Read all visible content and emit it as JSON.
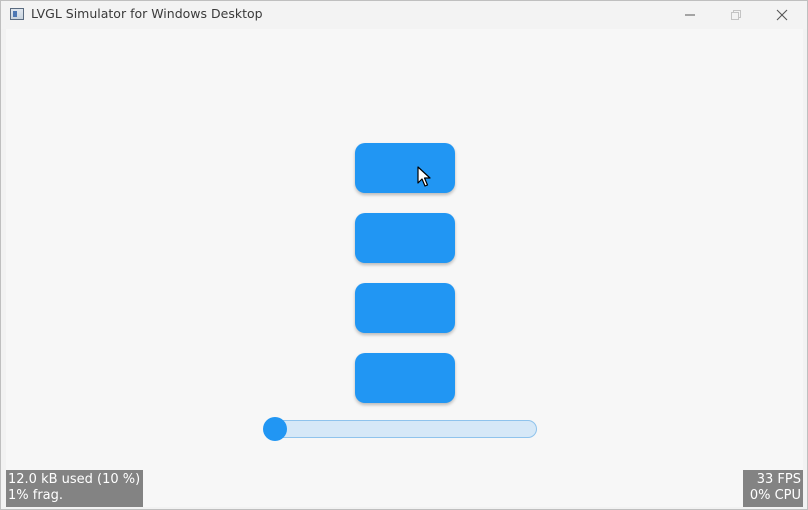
{
  "window": {
    "title": "LVGL Simulator for Windows Desktop",
    "controls": {
      "minimize_icon": "minimize-icon",
      "maximize_icon": "maximize-icon",
      "close_icon": "close-icon"
    }
  },
  "buttons": [
    {
      "label": ""
    },
    {
      "label": ""
    },
    {
      "label": ""
    },
    {
      "label": ""
    }
  ],
  "slider": {
    "value_fraction": 0.0
  },
  "mem_monitor": {
    "used": "12.0 kB used (10 %)",
    "frag": "1% frag."
  },
  "perf_monitor": {
    "fps": "33 FPS",
    "cpu": "0% CPU"
  },
  "colors": {
    "accent": "#2196f3",
    "slider_track": "#d6e8f7",
    "background": "#f7f7f7",
    "overlay": "#6e6e6e"
  }
}
